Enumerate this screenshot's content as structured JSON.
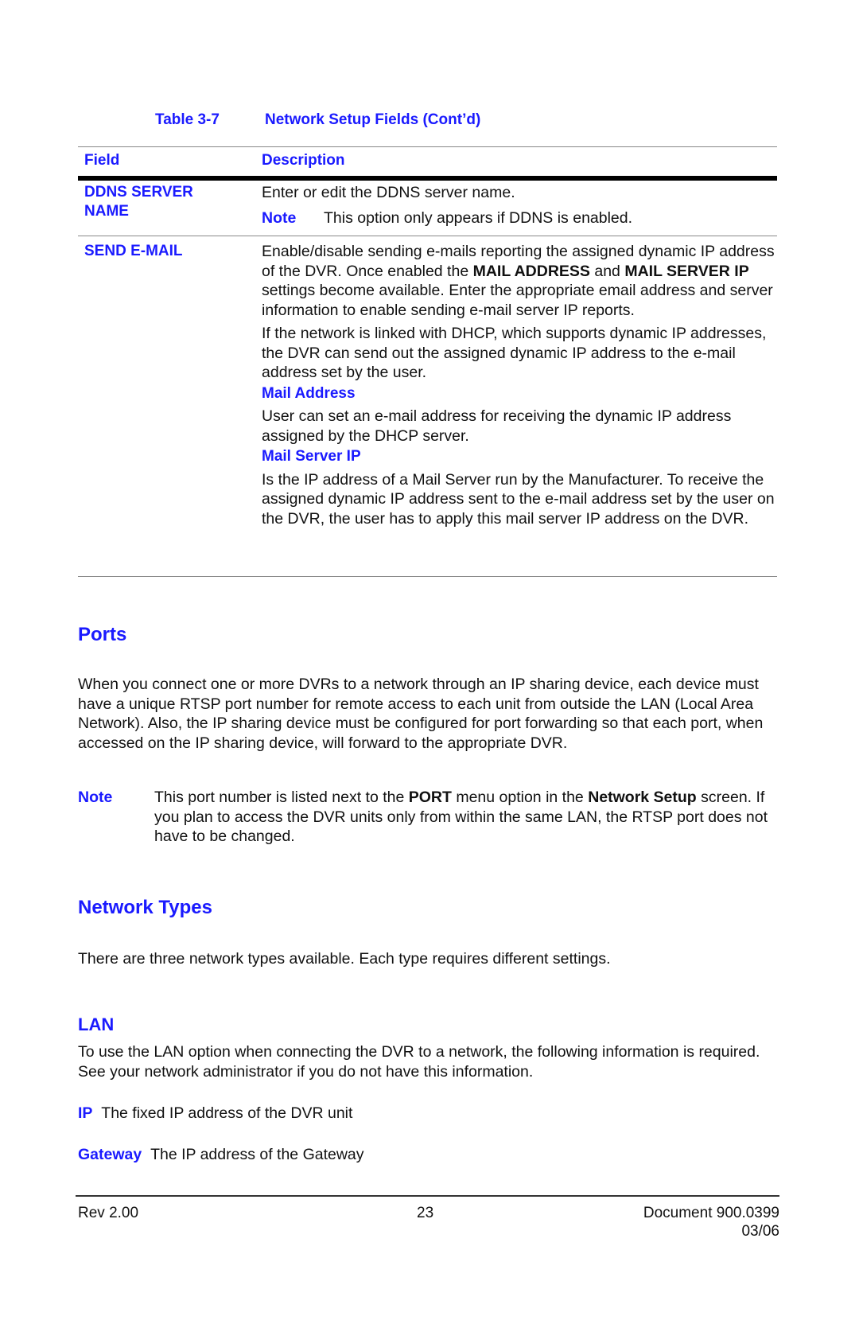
{
  "table": {
    "caption_number": "Table 3-7",
    "caption_title": "Network Setup Fields  (Cont’d)",
    "headers": {
      "field": "Field",
      "description": "Description"
    },
    "rows": [
      {
        "field_line1": "DDNS SERVER",
        "field_line2": "NAME",
        "description": "Enter or edit the DDNS server name.",
        "note_label": "Note",
        "note_text": "This option only appears if DDNS is enabled."
      },
      {
        "field": "SEND E-MAIL",
        "para1_a": "Enable/disable sending e-mails reporting the assigned dynamic IP address of the DVR. Once enabled the ",
        "para1_bold1": "MAIL ADDRESS",
        "para1_b": " and ",
        "para1_bold2": "MAIL SERVER IP",
        "para1_c": " settings become available. Enter the appropriate email address and server information to enable sending e-mail server IP reports.",
        "para2": "If the network is linked with DHCP, which supports dynamic IP addresses, the DVR can send out the assigned dynamic IP address to the e-mail address set by the user.",
        "sub1_title": "Mail Address",
        "sub1_text": "User can set an e-mail address for receiving the dynamic IP address assigned by the DHCP server.",
        "sub2_title": "Mail Server IP",
        "sub2_text": "Is the IP address of a Mail Server run by the Manufacturer. To receive the assigned dynamic IP address sent to the e-mail address set by the user on the DVR, the user has to apply this mail server IP address on the DVR."
      }
    ]
  },
  "ports": {
    "heading": "Ports",
    "body": "When you connect one or more DVRs to a network through an IP sharing device, each device must have a unique RTSP port number for remote access to each unit from outside the LAN (Local Area Network). Also, the IP sharing device must be configured for port forwarding so that each port, when accessed on the IP sharing device, will forward to the appropriate DVR.",
    "note_label": "Note",
    "note_a": "This port number is listed next to the ",
    "note_bold1": "PORT",
    "note_b": " menu option in the ",
    "note_bold2": "Network Setup",
    "note_c": " screen. If you plan to access the DVR units only from within the same LAN, the RTSP port does not have to be changed."
  },
  "network_types": {
    "heading": "Network Types",
    "body": "There are three network types available. Each type requires different settings."
  },
  "lan": {
    "heading": "LAN",
    "body": "To use the LAN option when connecting the DVR to a network, the following information is required. See your network administrator if you do not have this information.",
    "items": [
      {
        "label": "IP",
        "text": "The fixed IP address of the DVR unit"
      },
      {
        "label": "Gateway",
        "text": "The IP address of the Gateway"
      }
    ]
  },
  "footer": {
    "rev": "Rev 2.00",
    "page": "23",
    "document": "Document 900.0399",
    "date": "03/06"
  }
}
